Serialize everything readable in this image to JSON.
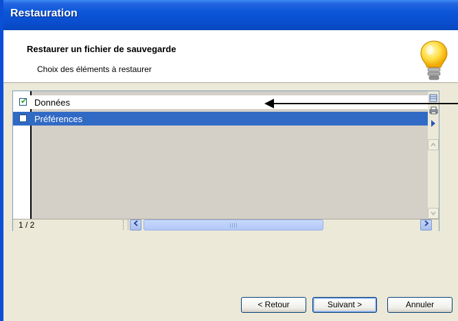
{
  "window": {
    "title": "Restauration"
  },
  "header": {
    "title": "Restaurer un fichier de sauvegarde",
    "subtitle": "Choix des éléments à restaurer",
    "icon": "lightbulb-icon"
  },
  "list": {
    "items": [
      {
        "label": "Données",
        "checked": true,
        "selected": false
      },
      {
        "label": "Préférences",
        "checked": false,
        "selected": true
      }
    ],
    "counter": "1 / 2"
  },
  "toolbar": {
    "icons": [
      "table-view-icon",
      "print-icon",
      "expand-arrow-icon"
    ]
  },
  "buttons": {
    "back": "< Retour",
    "next": "Suivant >",
    "cancel": "Annuler"
  },
  "colors": {
    "title_bar": "#0a4fd0",
    "selection": "#316ac5",
    "checkmark": "#21a121"
  }
}
